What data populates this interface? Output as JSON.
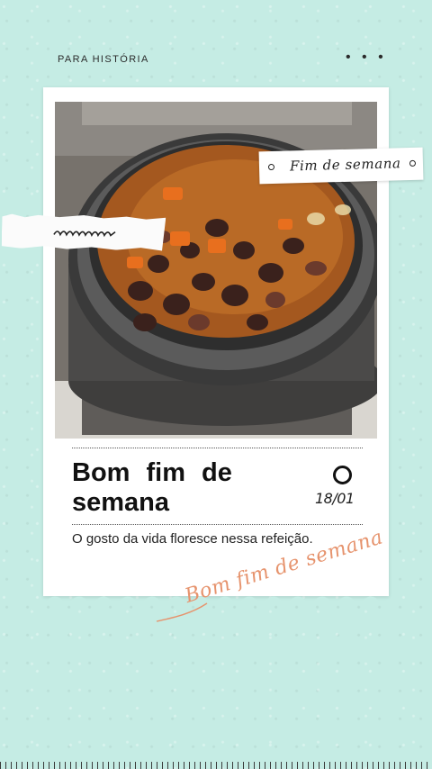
{
  "header": {
    "label": "PARA HISTÓRIA",
    "more_menu": "• • •"
  },
  "photo": {
    "description_icon": "food-photo"
  },
  "sticker": {
    "text": "Fim de semana"
  },
  "card": {
    "title": "Bom fim de semana",
    "date": "18/01",
    "subtitle": "O gosto da vida floresce nessa refeição."
  },
  "script_text": "Bom fim de semana",
  "colors": {
    "background": "#c5ece4",
    "accent": "#e6936d",
    "card": "#ffffff"
  }
}
